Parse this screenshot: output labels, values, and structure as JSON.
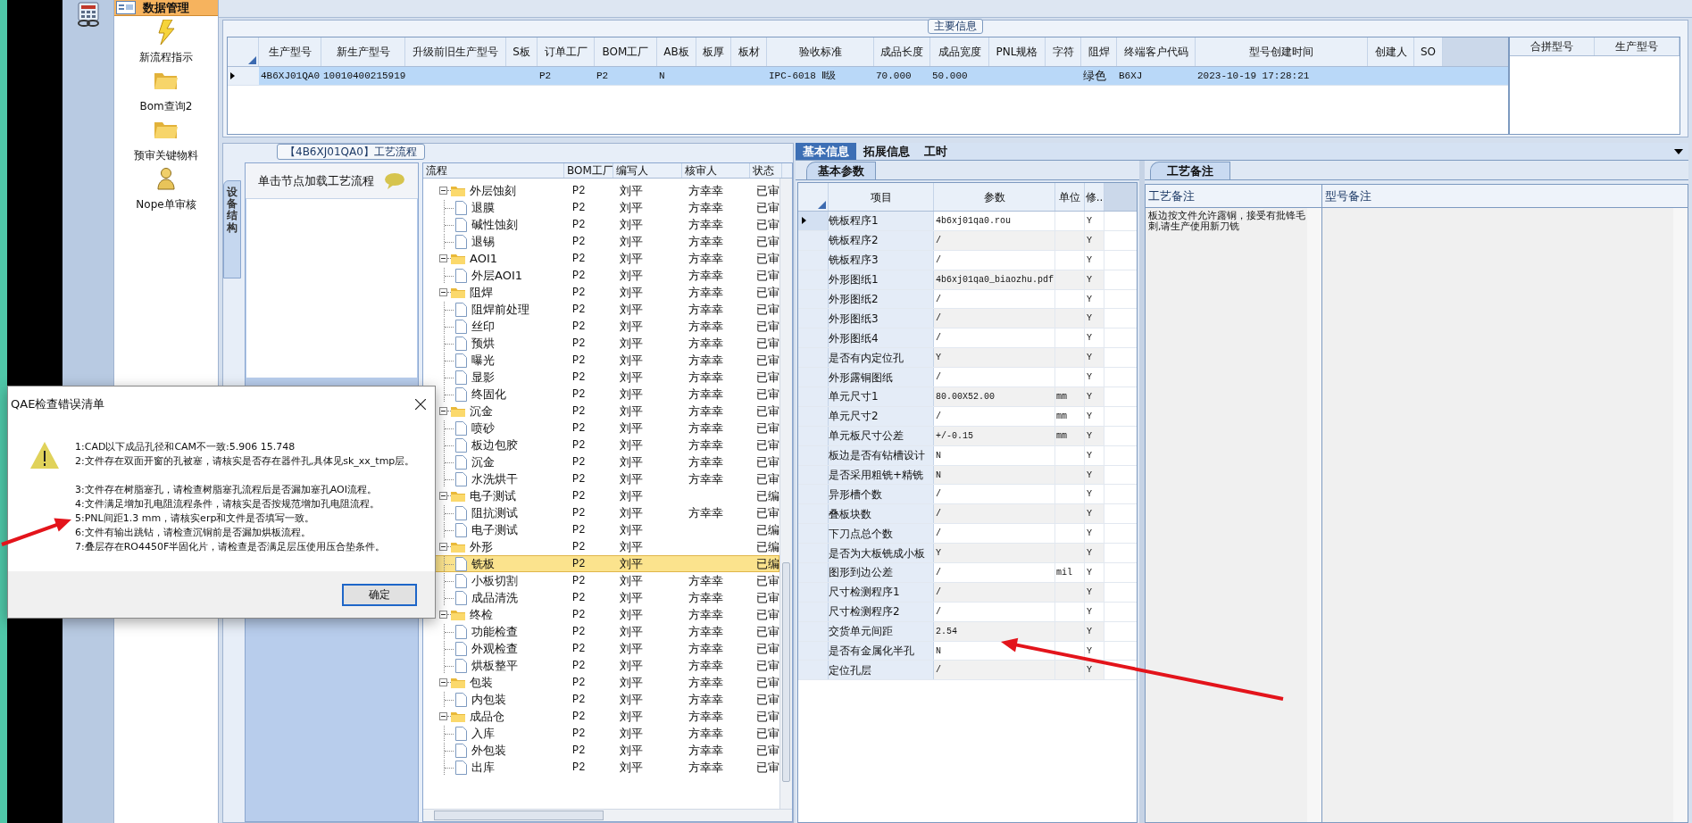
{
  "sidebar": {
    "header": "数据管理",
    "items": [
      {
        "label": "新流程指示",
        "kind": "lightning"
      },
      {
        "label": "Bom查询2",
        "kind": "folder"
      },
      {
        "label": "预审关键物料",
        "kind": "folder"
      },
      {
        "label": "Nope单审核",
        "kind": "person"
      }
    ]
  },
  "main_info": {
    "title": "主要信息",
    "columns": [
      "生产型号",
      "新生产型号",
      "升级前旧生产型号",
      "S板",
      "订单工厂",
      "BOM工厂",
      "AB板",
      "板厚",
      "板材",
      "验收标准",
      "成品长度",
      "成品宽度",
      "PNL规格",
      "字符",
      "阻焊",
      "终端客户代码",
      "型号创建时间",
      "创建人",
      "SO"
    ],
    "rows": [
      {
        "selected": true,
        "cells": [
          "4B6XJ01QA0",
          "10010400215919",
          null,
          null,
          "P2",
          "P2",
          "N",
          null,
          null,
          "IPC-6018 Ⅱ级",
          "70.000",
          "50.000",
          null,
          null,
          "绿色",
          "B6XJ",
          "2023-10-19 17:28:21",
          null,
          null
        ]
      }
    ]
  },
  "merge_table": {
    "columns": [
      "合拼型号",
      "生产型号"
    ]
  },
  "process": {
    "title": "【4B6XJ01QA0】工艺流程",
    "side_tab": "设备结构",
    "hint": "单击节点加载工艺流程",
    "columns": [
      "流程",
      "BOM工厂",
      "编写人",
      "核审人",
      "状态"
    ],
    "nodes": [
      {
        "name": "外层蚀刻",
        "bom": "P2",
        "writer": "刘平",
        "reviewer": "方幸幸",
        "status": "已审",
        "expanded": true,
        "selected": false,
        "children": [
          {
            "name": "退膜",
            "bom": "P2",
            "writer": "刘平",
            "reviewer": "方幸幸",
            "status": "已审",
            "selected": false
          },
          {
            "name": "碱性蚀刻",
            "bom": "P2",
            "writer": "刘平",
            "reviewer": "方幸幸",
            "status": "已审",
            "selected": false
          },
          {
            "name": "退锡",
            "bom": "P2",
            "writer": "刘平",
            "reviewer": "方幸幸",
            "status": "已审",
            "selected": false
          }
        ]
      },
      {
        "name": "AOI1",
        "bom": "P2",
        "writer": "刘平",
        "reviewer": "方幸幸",
        "status": "已审",
        "expanded": true,
        "selected": false,
        "children": [
          {
            "name": "外层AOI1",
            "bom": "P2",
            "writer": "刘平",
            "reviewer": "方幸幸",
            "status": "已审",
            "selected": false
          }
        ]
      },
      {
        "name": "阻焊",
        "bom": "P2",
        "writer": "刘平",
        "reviewer": "方幸幸",
        "status": "已审",
        "expanded": true,
        "selected": false,
        "children": [
          {
            "name": "阻焊前处理",
            "bom": "P2",
            "writer": "刘平",
            "reviewer": "方幸幸",
            "status": "已审",
            "selected": false
          },
          {
            "name": "丝印",
            "bom": "P2",
            "writer": "刘平",
            "reviewer": "方幸幸",
            "status": "已审",
            "selected": false
          },
          {
            "name": "预烘",
            "bom": "P2",
            "writer": "刘平",
            "reviewer": "方幸幸",
            "status": "已审",
            "selected": false
          },
          {
            "name": "曝光",
            "bom": "P2",
            "writer": "刘平",
            "reviewer": "方幸幸",
            "status": "已审",
            "selected": false
          },
          {
            "name": "显影",
            "bom": "P2",
            "writer": "刘平",
            "reviewer": "方幸幸",
            "status": "已审",
            "selected": false
          },
          {
            "name": "终固化",
            "bom": "P2",
            "writer": "刘平",
            "reviewer": "方幸幸",
            "status": "已审",
            "selected": false
          }
        ]
      },
      {
        "name": "沉金",
        "bom": "P2",
        "writer": "刘平",
        "reviewer": "方幸幸",
        "status": "已审",
        "expanded": true,
        "selected": false,
        "children": [
          {
            "name": "喷砂",
            "bom": "P2",
            "writer": "刘平",
            "reviewer": "方幸幸",
            "status": "已审",
            "selected": false
          },
          {
            "name": "板边包胶",
            "bom": "P2",
            "writer": "刘平",
            "reviewer": "方幸幸",
            "status": "已审",
            "selected": false
          },
          {
            "name": "沉金",
            "bom": "P2",
            "writer": "刘平",
            "reviewer": "方幸幸",
            "status": "已审",
            "selected": false
          },
          {
            "name": "水洗烘干",
            "bom": "P2",
            "writer": "刘平",
            "reviewer": "方幸幸",
            "status": "已审",
            "selected": false
          }
        ]
      },
      {
        "name": "电子测试",
        "bom": "P2",
        "writer": "刘平",
        "status": "已编",
        "expanded": true,
        "selected": false,
        "children": [
          {
            "name": "阻抗测试",
            "bom": "P2",
            "writer": "刘平",
            "reviewer": "方幸幸",
            "status": "已审",
            "selected": false
          },
          {
            "name": "电子测试",
            "bom": "P2",
            "writer": "刘平",
            "status": "已编",
            "selected": false
          }
        ]
      },
      {
        "name": "外形",
        "bom": "P2",
        "writer": "刘平",
        "status": "已编",
        "expanded": true,
        "selected": false,
        "children": [
          {
            "name": "铣板",
            "bom": "P2",
            "writer": "刘平",
            "status": "已编",
            "selected": true
          },
          {
            "name": "小板切割",
            "bom": "P2",
            "writer": "刘平",
            "reviewer": "方幸幸",
            "status": "已审",
            "selected": false
          },
          {
            "name": "成品清洗",
            "bom": "P2",
            "writer": "刘平",
            "reviewer": "方幸幸",
            "status": "已审",
            "selected": false
          }
        ]
      },
      {
        "name": "终检",
        "bom": "P2",
        "writer": "刘平",
        "reviewer": "方幸幸",
        "status": "已审",
        "expanded": true,
        "selected": false,
        "children": [
          {
            "name": "功能检查",
            "bom": "P2",
            "writer": "刘平",
            "reviewer": "方幸幸",
            "status": "已审",
            "selected": false
          },
          {
            "name": "外观检查",
            "bom": "P2",
            "writer": "刘平",
            "reviewer": "方幸幸",
            "status": "已审",
            "selected": false
          },
          {
            "name": "烘板整平",
            "bom": "P2",
            "writer": "刘平",
            "reviewer": "方幸幸",
            "status": "已审",
            "selected": false
          }
        ]
      },
      {
        "name": "包装",
        "bom": "P2",
        "writer": "刘平",
        "reviewer": "方幸幸",
        "status": "已审",
        "expanded": true,
        "selected": false,
        "children": [
          {
            "name": "内包装",
            "bom": "P2",
            "writer": "刘平",
            "reviewer": "方幸幸",
            "status": "已审",
            "selected": false
          }
        ]
      },
      {
        "name": "成品仓",
        "bom": "P2",
        "writer": "刘平",
        "reviewer": "方幸幸",
        "status": "已审",
        "expanded": true,
        "selected": false,
        "children": [
          {
            "name": "入库",
            "bom": "P2",
            "writer": "刘平",
            "reviewer": "方幸幸",
            "status": "已审",
            "selected": false
          },
          {
            "name": "外包装",
            "bom": "P2",
            "writer": "刘平",
            "reviewer": "方幸幸",
            "status": "已审",
            "selected": false
          },
          {
            "name": "出库",
            "bom": "P2",
            "writer": "刘平",
            "reviewer": "方幸幸",
            "status": "已审",
            "selected": false
          }
        ]
      }
    ]
  },
  "detail_tabs": [
    {
      "label": "基本信息",
      "selected": true
    },
    {
      "label": "拓展信息",
      "selected": false
    },
    {
      "label": "工时",
      "selected": false
    }
  ],
  "params": {
    "tab": "基本参数",
    "columns": [
      "项目",
      "参数",
      "单位",
      "修.."
    ],
    "rows": [
      {
        "item": "铣板程序1",
        "value": "4b6xj01qa0.rou",
        "unit": null,
        "flag": "Y",
        "selected": true
      },
      {
        "item": "铣板程序2",
        "value": "/",
        "unit": null,
        "flag": "Y",
        "selected": false
      },
      {
        "item": "铣板程序3",
        "value": "/",
        "unit": null,
        "flag": "Y",
        "selected": false
      },
      {
        "item": "外形图纸1",
        "value": "4b6xj01qa0_biaozhu.pdf",
        "unit": null,
        "flag": "Y",
        "selected": false
      },
      {
        "item": "外形图纸2",
        "value": "/",
        "unit": null,
        "flag": "Y",
        "selected": false
      },
      {
        "item": "外形图纸3",
        "value": "/",
        "unit": null,
        "flag": "Y",
        "selected": false
      },
      {
        "item": "外形图纸4",
        "value": "/",
        "unit": null,
        "flag": "Y",
        "selected": false
      },
      {
        "item": "是否有内定位孔",
        "value": "Y",
        "unit": null,
        "flag": "Y",
        "selected": false
      },
      {
        "item": "外形露铜图纸",
        "value": "/",
        "unit": null,
        "flag": "Y",
        "selected": false
      },
      {
        "item": "单元尺寸1",
        "value": "80.00X52.00",
        "unit": "mm",
        "flag": "Y",
        "selected": false
      },
      {
        "item": "单元尺寸2",
        "value": "/",
        "unit": "mm",
        "flag": "Y",
        "selected": false
      },
      {
        "item": "单元板尺寸公差",
        "value": "+/-0.15",
        "unit": "mm",
        "flag": "Y",
        "selected": false
      },
      {
        "item": "板边是否有钻槽设计",
        "value": "N",
        "unit": null,
        "flag": "Y",
        "selected": false
      },
      {
        "item": "是否采用粗铣+精铣",
        "value": "N",
        "unit": null,
        "flag": "Y",
        "selected": false
      },
      {
        "item": "异形槽个数",
        "value": "/",
        "unit": null,
        "flag": "Y",
        "selected": false
      },
      {
        "item": "叠板块数",
        "value": "/",
        "unit": null,
        "flag": "Y",
        "selected": false
      },
      {
        "item": "下刀点总个数",
        "value": "/",
        "unit": null,
        "flag": "Y",
        "selected": false
      },
      {
        "item": "是否为大板铣成小板",
        "value": "Y",
        "unit": null,
        "flag": "Y",
        "selected": false
      },
      {
        "item": "图形到边公差",
        "value": "/",
        "unit": "mil",
        "flag": "Y",
        "selected": false
      },
      {
        "item": "尺寸检测程序1",
        "value": "/",
        "unit": null,
        "flag": "Y",
        "selected": false
      },
      {
        "item": "尺寸检测程序2",
        "value": "/",
        "unit": null,
        "flag": "Y",
        "selected": false
      },
      {
        "item": "交货单元间距",
        "value": "2.54",
        "unit": null,
        "flag": "Y",
        "selected": false
      },
      {
        "item": "是否有金属化半孔",
        "value": "N",
        "unit": null,
        "flag": "Y",
        "selected": false
      },
      {
        "item": "定位孔层",
        "value": "/",
        "unit": null,
        "flag": "Y",
        "selected": false
      }
    ]
  },
  "notes": {
    "tab": "工艺备注",
    "columns": [
      "工艺备注",
      "型号备注"
    ],
    "process_note": "板边按文件允许露铜，接受有批锋毛刺,请生产使用新刀铣"
  },
  "dialog": {
    "title": "QAE检查错误清单",
    "groups": [
      [
        "1:CAD以下成品孔径和CAM不一致:5.906 15.748",
        "2:文件存在双面开窗的孔被塞，请核实是否存在器件孔,具体见sk_xx_tmp层。"
      ],
      [
        "3:文件存在树脂塞孔，请检查树脂塞孔流程后是否漏加塞孔AOI流程。",
        "4:文件满足增加孔电阻流程条件，请核实是否按规范增加孔电阻流程。",
        "5:PNL间距1.3 mm，请核实erp和文件是否填写一致。",
        "6:文件有输出跳钻，请检查沉铜前是否漏加烘板流程。",
        "7:叠层存在RO4450F半固化片，请检查是否满足层压使用压合垫条件。"
      ]
    ],
    "button": "确定"
  }
}
